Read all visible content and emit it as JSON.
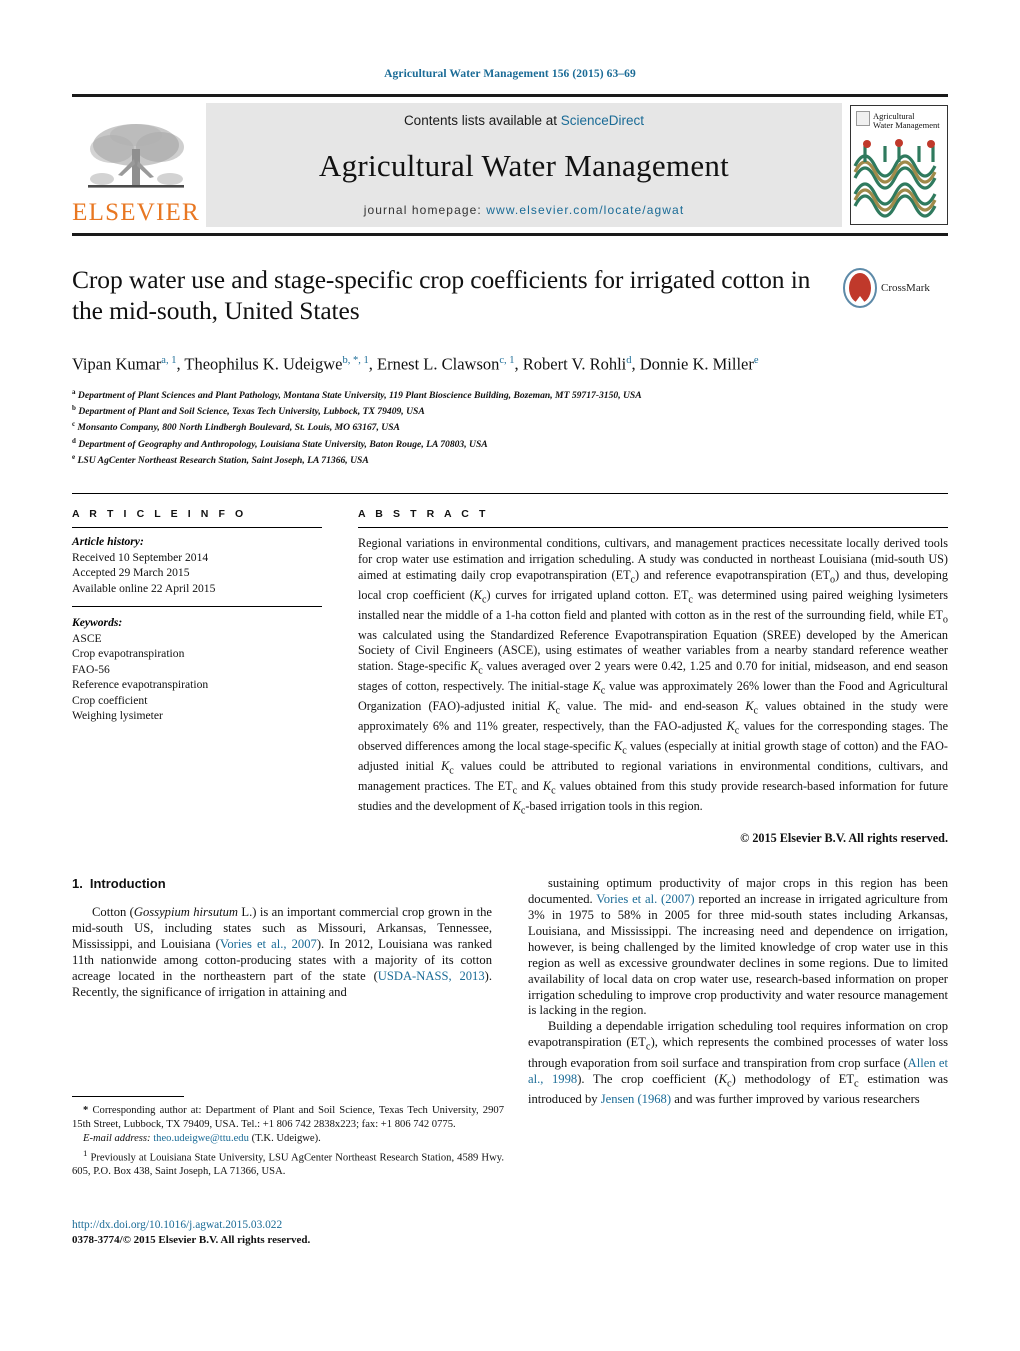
{
  "running_head": "Agricultural Water Management 156 (2015) 63–69",
  "masthead": {
    "contents_prefix": "Contents lists available at ",
    "contents_link": "ScienceDirect",
    "journal_title": "Agricultural Water Management",
    "homepage_prefix": "journal homepage: ",
    "homepage_url": "www.elsevier.com/locate/agwat",
    "publisher": "ELSEVIER",
    "cover_title_line1": "Agricultural",
    "cover_title_line2": "Water Management"
  },
  "article": {
    "title": "Crop water use and stage-specific crop coefficients for irrigated cotton in the mid-south, United States",
    "crossmark_label": "CrossMark",
    "authors_html": "Vipan Kumar<sup>a, 1</sup>, Theophilus K. Udeigwe<sup>b, *, 1</sup>, Ernest L. Clawson<sup>c, 1</sup>, Robert V. Rohli<sup>d</sup>, Donnie K. Miller<sup>e</sup>",
    "affiliations": [
      {
        "marker": "a",
        "text": "Department of Plant Sciences and Plant Pathology, Montana State University, 119 Plant Bioscience Building, Bozeman, MT 59717-3150, USA"
      },
      {
        "marker": "b",
        "text": "Department of Plant and Soil Science, Texas Tech University, Lubbock, TX 79409, USA"
      },
      {
        "marker": "c",
        "text": "Monsanto Company, 800 North Lindbergh Boulevard, St. Louis, MO 63167, USA"
      },
      {
        "marker": "d",
        "text": "Department of Geography and Anthropology, Louisiana State University, Baton Rouge, LA 70803, USA"
      },
      {
        "marker": "e",
        "text": "LSU AgCenter Northeast Research Station, Saint Joseph, LA 71366, USA"
      }
    ]
  },
  "article_info": {
    "heading": "A R T I C L E   I N F O",
    "history_label": "Article history:",
    "history": [
      "Received 10 September 2014",
      "Accepted 29 March 2015",
      "Available online 22 April 2015"
    ],
    "keywords_label": "Keywords:",
    "keywords": [
      "ASCE",
      "Crop evapotranspiration",
      "FAO-56",
      "Reference evapotranspiration",
      "Crop coefficient",
      "Weighing lysimeter"
    ]
  },
  "abstract": {
    "heading": "A B S T R A C T",
    "text_html": "Regional variations in environmental conditions, cultivars, and management practices necessitate locally derived tools for crop water use estimation and irrigation scheduling. A study was conducted in northeast Louisiana (mid-south US) aimed at estimating daily crop evapotranspiration (ET<sub>c</sub>) and reference evapotranspiration (ET<sub>o</sub>) and thus, developing local crop coefficient (<em>K</em><sub>c</sub>) curves for irrigated upland cotton. ET<sub>c</sub> was determined using paired weighing lysimeters installed near the middle of a 1-ha cotton field and planted with cotton as in the rest of the surrounding field, while ET<sub>o</sub> was calculated using the Standardized Reference Evapotranspiration Equation (SREE) developed by the American Society of Civil Engineers (ASCE), using estimates of weather variables from a nearby standard reference weather station. Stage-specific <em>K</em><sub>c</sub> values averaged over 2 years were 0.42, 1.25 and 0.70 for initial, midseason, and end season stages of cotton, respectively. The initial-stage <em>K</em><sub>c</sub> value was approximately 26% lower than the Food and Agricultural Organization (FAO)-adjusted initial <em>K</em><sub>c</sub> value. The mid- and end-season <em>K</em><sub>c</sub> values obtained in the study were approximately 6% and 11% greater, respectively, than the FAO-adjusted <em>K</em><sub>c</sub> values for the corresponding stages. The observed differences among the local stage-specific <em>K</em><sub>c</sub> values (especially at initial growth stage of cotton) and the FAO-adjusted initial <em>K</em><sub>c</sub> values could be attributed to regional variations in environmental conditions, cultivars, and management practices. The ET<sub>c</sub> and <em>K</em><sub>c</sub> values obtained from this study provide research-based information for future studies and the development of <em>K</em><sub>c</sub>-based irrigation tools in this region.",
    "copyright": "© 2015 Elsevier B.V. All rights reserved."
  },
  "introduction": {
    "number": "1.",
    "heading": "Introduction",
    "left_paragraph_html": "Cotton (<em>Gossypium hirsutum</em> L.) is an important commercial crop grown in the mid-south US, including states such as Missouri, Arkansas, Tennessee, Mississippi, and Louisiana (<span class=\"cite\">Vories et al., 2007</span>). In 2012, Louisiana was ranked 11th nationwide among cotton-producing states with a majority of its cotton acreage located in the northeastern part of the state (<span class=\"cite\">USDA-NASS, 2013</span>). Recently, the significance of irrigation in attaining and",
    "right_paragraph_1_html": "sustaining optimum productivity of major crops in this region has been documented. <span class=\"cite\">Vories et al. (2007)</span> reported an increase in irrigated agriculture from 3% in 1975 to 58% in 2005 for three mid-south states including Arkansas, Louisiana, and Mississippi. The increasing need and dependence on irrigation, however, is being challenged by the limited knowledge of crop water use in this region as well as excessive groundwater declines in some regions. Due to limited availability of local data on crop water use, research-based information on proper irrigation scheduling to improve crop productivity and water resource management is lacking in the region.",
    "right_paragraph_2_html": "Building a dependable irrigation scheduling tool requires information on crop evapotranspiration (ET<sub>c</sub>), which represents the combined processes of water loss through evaporation from soil surface and transpiration from crop surface (<span class=\"cite\">Allen et al., 1998</span>). The crop coefficient (<em>K</em><sub>c</sub>) methodology of ET<sub>c</sub> estimation was introduced by <span class=\"cite\">Jensen (1968)</span> and was further improved by various researchers"
  },
  "footnotes": {
    "corresponding_html": "<strong>*</strong> Corresponding author at: Department of Plant and Soil Science, Texas Tech University, 2907 15th Street, Lubbock, TX 79409, USA. Tel.: +1 806 742 2838x223; fax: +1 806 742 0775.",
    "email_label": "E-mail address:",
    "email": "theo.udeigwe@ttu.edu",
    "email_suffix": "(T.K. Udeigwe).",
    "note1_html": "<sup>1</sup> Previously at Louisiana State University, LSU AgCenter Northeast Research Station, 4589 Hwy. 605, P.O. Box 438, Saint Joseph, LA 71366, USA."
  },
  "footer": {
    "doi": "http://dx.doi.org/10.1016/j.agwat.2015.03.022",
    "issn_line": "0378-3774/© 2015 Elsevier B.V. All rights reserved."
  },
  "colors": {
    "link": "#1a6b96",
    "elsevier_orange": "#e87722",
    "band_gray": "#e6e6e6"
  }
}
